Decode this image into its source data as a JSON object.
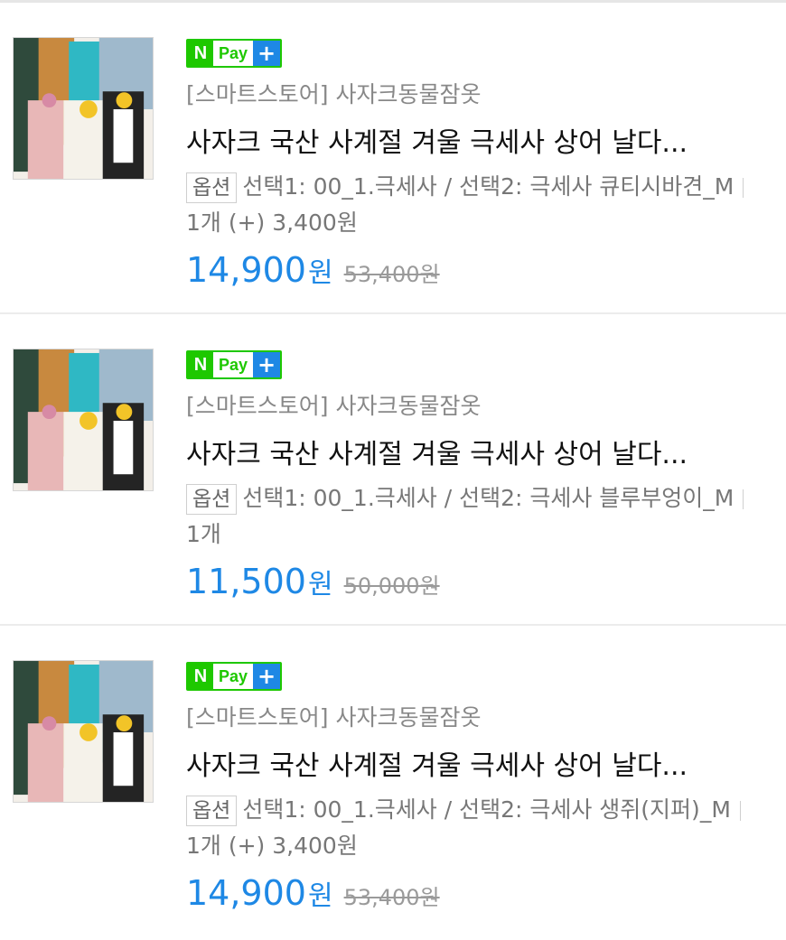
{
  "items": [
    {
      "badge": {
        "n": "N",
        "pay": "Pay",
        "plus": "+"
      },
      "store": "[스마트스토어] 사자크동물잠옷",
      "title": "사자크 국산 사계절 겨울 극세사 상어 날다...",
      "option_label": "옵션",
      "option_text": "선택1: 00_1.극세사 / 선택2: 극세사 큐티시바견_M",
      "quantity_text": "1개 (+) 3,400원",
      "price": "14,900",
      "price_unit": "원",
      "original_price": "53,400원"
    },
    {
      "badge": {
        "n": "N",
        "pay": "Pay",
        "plus": "+"
      },
      "store": "[스마트스토어] 사자크동물잠옷",
      "title": "사자크 국산 사계절 겨울 극세사 상어 날다...",
      "option_label": "옵션",
      "option_text": "선택1: 00_1.극세사 / 선택2: 극세사 블루부엉이_M",
      "quantity_text": "1개",
      "price": "11,500",
      "price_unit": "원",
      "original_price": "50,000원"
    },
    {
      "badge": {
        "n": "N",
        "pay": "Pay",
        "plus": "+"
      },
      "store": "[스마트스토어] 사자크동물잠옷",
      "title": "사자크 국산 사계절 겨울 극세사 상어 날다...",
      "option_label": "옵션",
      "option_text": "선택1: 00_1.극세사 / 선택2: 극세사 생쥐(지퍼)_M",
      "quantity_text": "1개 (+) 3,400원",
      "price": "14,900",
      "price_unit": "원",
      "original_price": "53,400원"
    }
  ],
  "colors": {
    "accent": "#1e88e5",
    "npay_green": "#1ec800",
    "muted": "#888888"
  }
}
